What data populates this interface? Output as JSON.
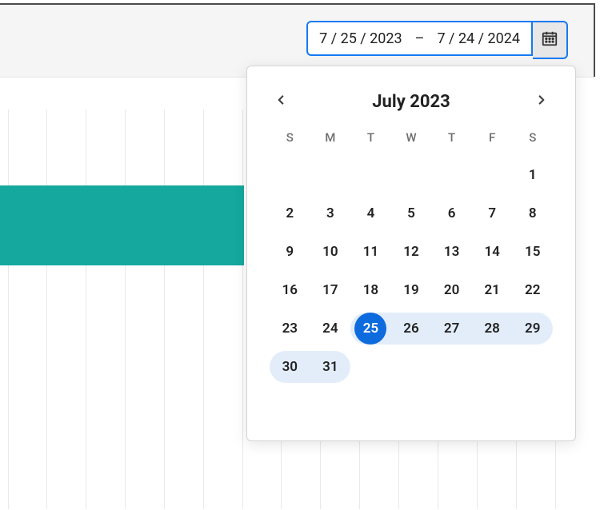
{
  "dateRange": {
    "start": "7 / 25 / 2023",
    "dash": "–",
    "end": "7 / 24 / 2024"
  },
  "calendar": {
    "title": "July 2023",
    "dow": [
      "S",
      "M",
      "T",
      "W",
      "T",
      "F",
      "S"
    ],
    "weeks": [
      [
        {
          "n": "",
          "state": "empty"
        },
        {
          "n": "",
          "state": "empty"
        },
        {
          "n": "",
          "state": "empty"
        },
        {
          "n": "",
          "state": "empty"
        },
        {
          "n": "",
          "state": "empty"
        },
        {
          "n": "",
          "state": "empty"
        },
        {
          "n": "1",
          "state": "plain"
        }
      ],
      [
        {
          "n": "2",
          "state": "plain"
        },
        {
          "n": "3",
          "state": "plain"
        },
        {
          "n": "4",
          "state": "plain"
        },
        {
          "n": "5",
          "state": "plain"
        },
        {
          "n": "6",
          "state": "plain"
        },
        {
          "n": "7",
          "state": "plain"
        },
        {
          "n": "8",
          "state": "plain"
        }
      ],
      [
        {
          "n": "9",
          "state": "plain"
        },
        {
          "n": "10",
          "state": "plain"
        },
        {
          "n": "11",
          "state": "plain"
        },
        {
          "n": "12",
          "state": "plain"
        },
        {
          "n": "13",
          "state": "plain"
        },
        {
          "n": "14",
          "state": "plain"
        },
        {
          "n": "15",
          "state": "plain"
        }
      ],
      [
        {
          "n": "16",
          "state": "plain"
        },
        {
          "n": "17",
          "state": "plain"
        },
        {
          "n": "18",
          "state": "plain"
        },
        {
          "n": "19",
          "state": "plain"
        },
        {
          "n": "20",
          "state": "plain"
        },
        {
          "n": "21",
          "state": "plain"
        },
        {
          "n": "22",
          "state": "plain"
        }
      ],
      [
        {
          "n": "23",
          "state": "plain"
        },
        {
          "n": "24",
          "state": "plain"
        },
        {
          "n": "25",
          "state": "sel-start"
        },
        {
          "n": "26",
          "state": "in-range"
        },
        {
          "n": "27",
          "state": "in-range"
        },
        {
          "n": "28",
          "state": "in-range"
        },
        {
          "n": "29",
          "state": "in-range cap-right"
        }
      ],
      [
        {
          "n": "30",
          "state": "in-range cap-left"
        },
        {
          "n": "31",
          "state": "in-range cap-right"
        },
        {
          "n": "",
          "state": "empty"
        },
        {
          "n": "",
          "state": "empty"
        },
        {
          "n": "",
          "state": "empty"
        },
        {
          "n": "",
          "state": "empty"
        },
        {
          "n": "",
          "state": "empty"
        }
      ]
    ]
  },
  "gridlineXs": [
    10,
    58,
    107,
    156,
    205,
    254,
    303,
    351,
    400,
    449,
    498,
    547,
    596,
    645,
    694
  ]
}
